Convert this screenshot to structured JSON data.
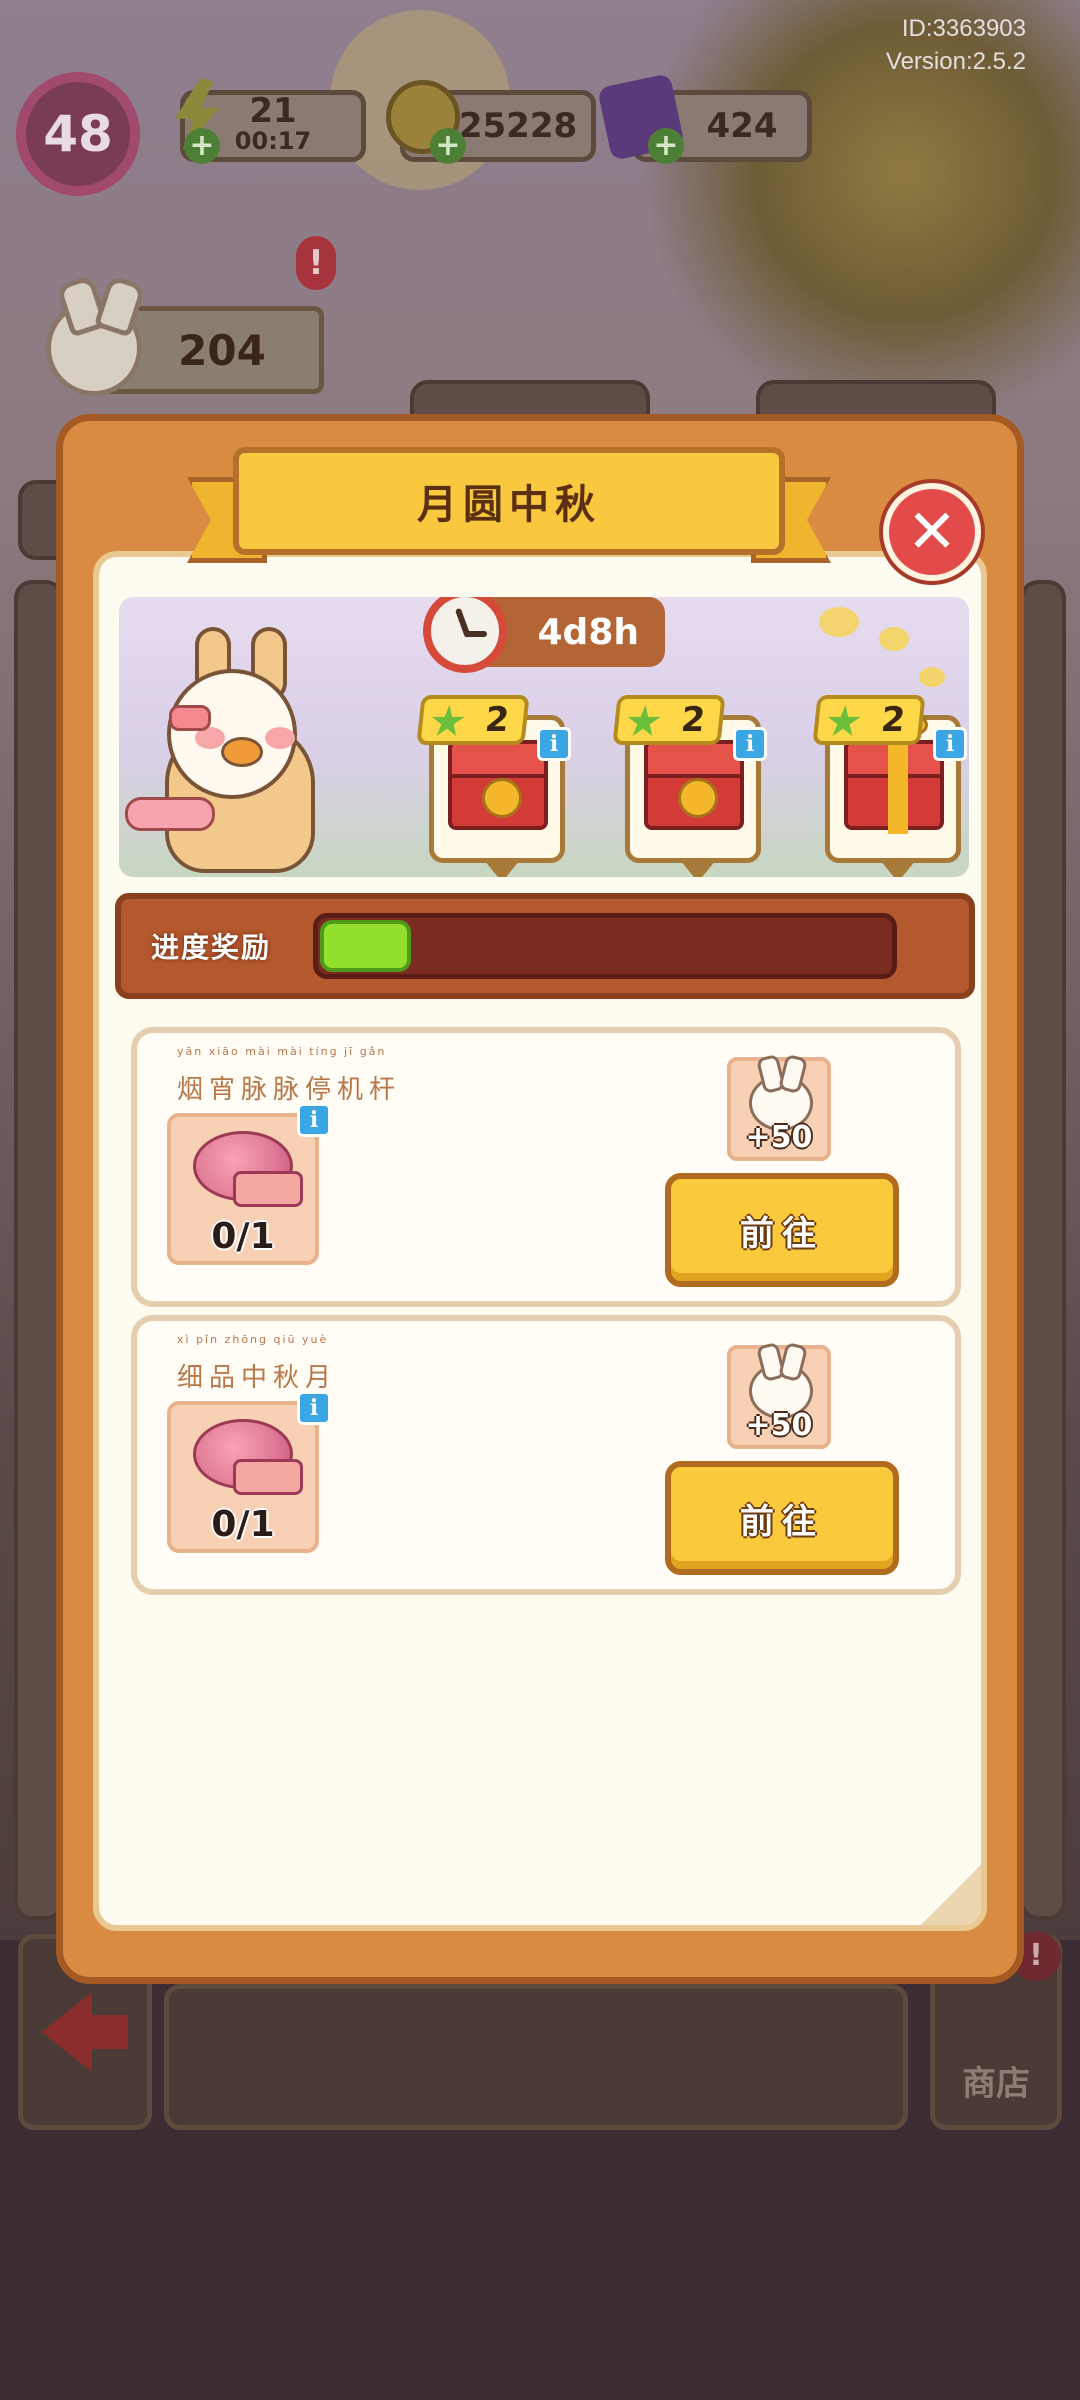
{
  "hud": {
    "id": "ID:3363903",
    "version": "Version:2.5.2",
    "level": "48",
    "energy": "21",
    "energy_timer": "00:17",
    "coins": "25228",
    "gems": "424",
    "score": "204",
    "alert": "!"
  },
  "event": {
    "title": "月圆中秋",
    "timer": "4d8h",
    "close_label": "✕",
    "rewards": [
      {
        "count": "2",
        "info": "i"
      },
      {
        "count": "2",
        "info": "i"
      },
      {
        "count": "2",
        "info": "i"
      }
    ],
    "progress_label": "进度奖励",
    "progress_fraction": 0.16
  },
  "tasks": [
    {
      "pinyin": "yān xiāo mài mài tíng jī gǎn",
      "title": "烟宵脉脉停机杆",
      "item_count": "0/1",
      "info": "i",
      "reward_amount": "+50",
      "button": "前往"
    },
    {
      "pinyin": "xì pǐn zhōng qiū yuè",
      "title": "细品中秋月",
      "item_count": "0/1",
      "info": "i",
      "reward_amount": "+50",
      "button": "前往"
    }
  ],
  "bottom": {
    "shop_label": "商店",
    "shop_alert": "!"
  }
}
